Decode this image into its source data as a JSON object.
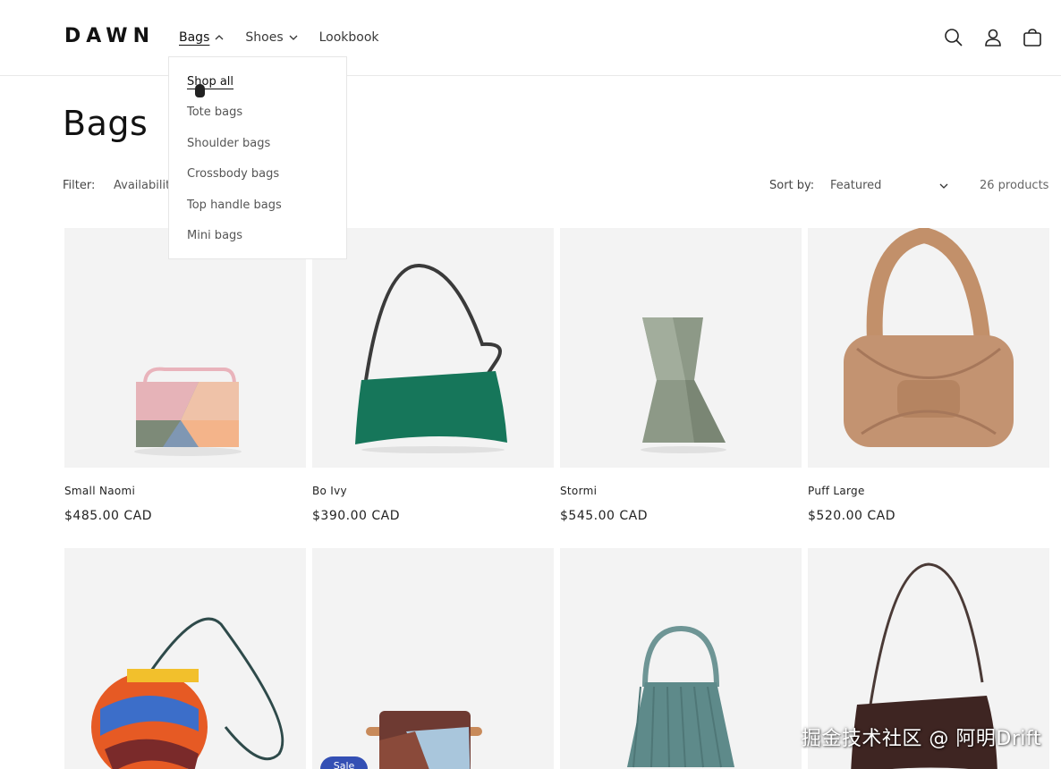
{
  "brand": {
    "logo": "DAWN"
  },
  "nav": [
    {
      "label": "Bags",
      "active": true
    },
    {
      "label": "Shoes",
      "active": false
    },
    {
      "label": "Lookbook",
      "active": false
    }
  ],
  "dropdown": {
    "items": [
      "Shop all",
      "Tote bags",
      "Shoulder bags",
      "Crossbody bags",
      "Top handle bags",
      "Mini bags"
    ]
  },
  "header_icons": [
    "search-icon",
    "account-icon",
    "cart-icon"
  ],
  "page": {
    "title": "Bags",
    "filter_label": "Filter:",
    "filter_availability": "Availabilit",
    "sort_label": "Sort by:",
    "sort_value": "Featured",
    "product_count": "26 products"
  },
  "products": [
    {
      "title": "Small Naomi",
      "price": "$485.00 CAD"
    },
    {
      "title": "Bo Ivy",
      "price": "$390.00 CAD"
    },
    {
      "title": "Stormi",
      "price": "$545.00 CAD"
    },
    {
      "title": "Puff Large",
      "price": "$520.00 CAD"
    },
    {
      "title": "",
      "price": ""
    },
    {
      "title": "",
      "price": "",
      "badge": "Sale"
    },
    {
      "title": "",
      "price": ""
    },
    {
      "title": "",
      "price": ""
    }
  ],
  "watermark": "掘金技术社区 @ 阿明Drift",
  "colors": {
    "accent": "#334fb4",
    "text": "#121212",
    "media_bg": "#f3f3f3"
  }
}
